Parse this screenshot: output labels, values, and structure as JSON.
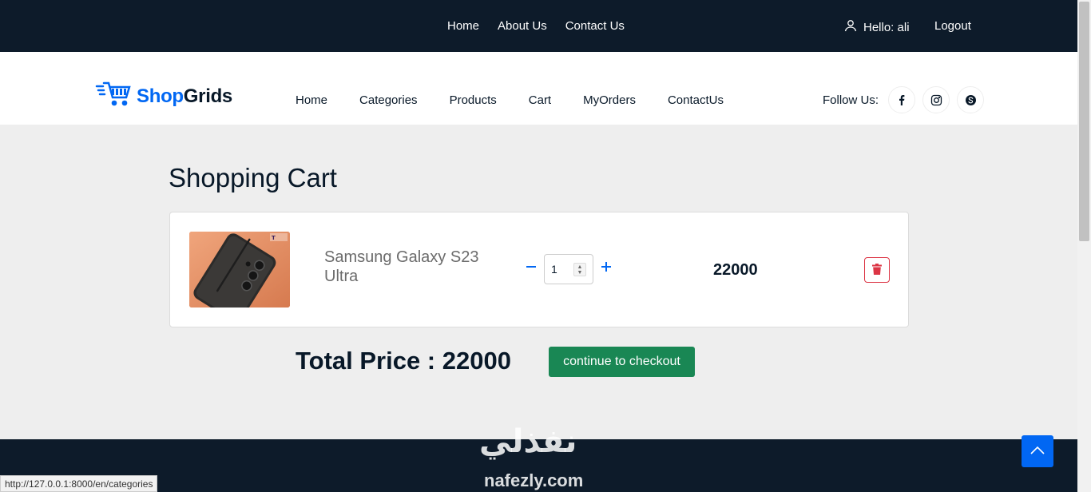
{
  "topbar": {
    "nav": [
      "Home",
      "About Us",
      "Contact Us"
    ],
    "greeting": "Hello: ali",
    "logout": "Logout"
  },
  "header": {
    "logo_shop": "Shop",
    "logo_grids": "Grids",
    "nav": [
      "Home",
      "Categories",
      "Products",
      "Cart",
      "MyOrders",
      "ContactUs"
    ],
    "follow_label": "Follow Us:",
    "social_icons": [
      "facebook-icon",
      "instagram-icon",
      "skype-icon"
    ]
  },
  "cart": {
    "title": "Shopping Cart",
    "items": [
      {
        "name": "Samsung Galaxy S23 Ultra",
        "quantity": "1",
        "price": "22000"
      }
    ],
    "total_label": "Total Price : 22000",
    "checkout_label": "continue to checkout"
  },
  "footer": {
    "watermark_ar": "نفذلي",
    "watermark_en": "nafezly.com"
  },
  "status_bar": {
    "url": "http://127.0.0.1:8000/en/categories"
  },
  "colors": {
    "dark_navy": "#0d1b2a",
    "accent_blue": "#0167f3",
    "checkout_green": "#198754",
    "danger_red": "#dc3545"
  }
}
